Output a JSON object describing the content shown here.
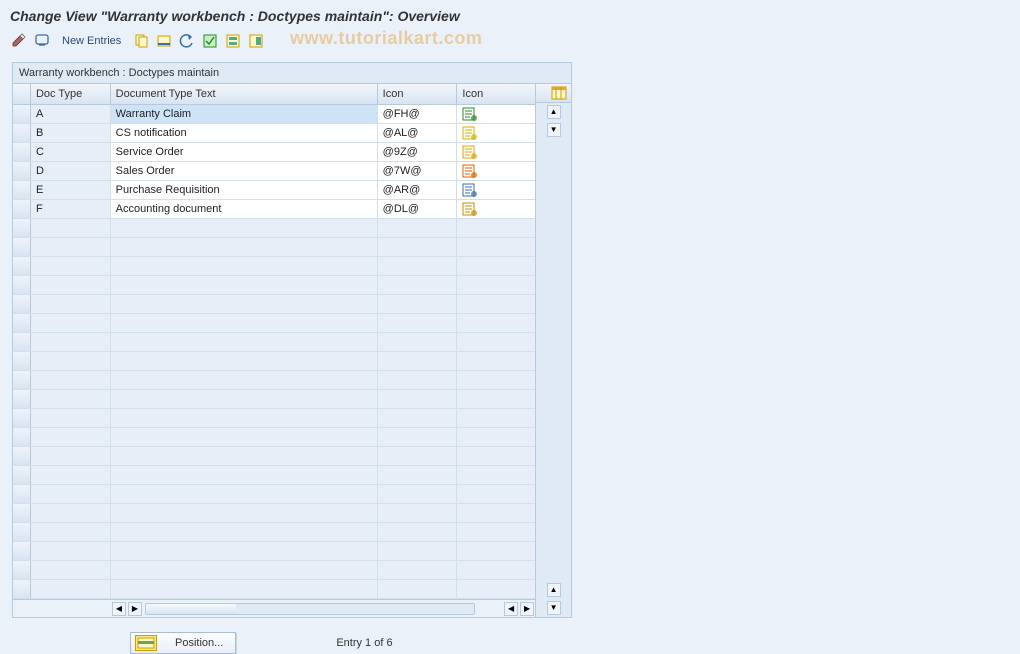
{
  "page_title": "Change View \"Warranty workbench : Doctypes maintain\": Overview",
  "toolbar": {
    "new_entries": "New Entries"
  },
  "watermark": "www.tutorialkart.com",
  "table": {
    "title": "Warranty workbench : Doctypes maintain",
    "headers": {
      "doc_type": "Doc Type",
      "doc_text": "Document Type Text",
      "icon1": "Icon",
      "icon2": "Icon"
    },
    "rows": [
      {
        "doc_type": "A",
        "doc_text": "Warranty Claim",
        "icon_code": "@FH@",
        "icon_name": "warranty-claim-icon"
      },
      {
        "doc_type": "B",
        "doc_text": "CS notification",
        "icon_code": "@AL@",
        "icon_name": "notification-icon"
      },
      {
        "doc_type": "C",
        "doc_text": "Service Order",
        "icon_code": "@9Z@",
        "icon_name": "service-order-icon"
      },
      {
        "doc_type": "D",
        "doc_text": "Sales Order",
        "icon_code": "@7W@",
        "icon_name": "sales-order-icon"
      },
      {
        "doc_type": "E",
        "doc_text": "Purchase Requisition",
        "icon_code": "@AR@",
        "icon_name": "purchase-req-icon"
      },
      {
        "doc_type": "F",
        "doc_text": "Accounting document",
        "icon_code": "@DL@",
        "icon_name": "accounting-doc-icon"
      }
    ],
    "empty_row_count": 20
  },
  "footer": {
    "position_label": "Position...",
    "entry_label": "Entry 1 of 6"
  }
}
